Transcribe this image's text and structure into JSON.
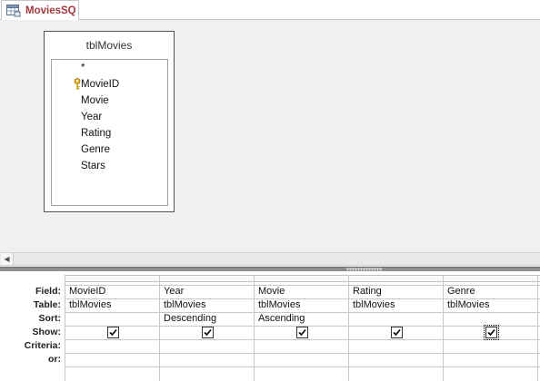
{
  "tab": {
    "label": "MoviesSQ"
  },
  "table": {
    "title": "tblMovies",
    "fields": [
      "*",
      "MovieID",
      "Movie",
      "Year",
      "Rating",
      "Genre",
      "Stars"
    ]
  },
  "grid": {
    "row_labels": [
      "Field:",
      "Table:",
      "Sort:",
      "Show:",
      "Criteria:",
      "or:"
    ],
    "columns": [
      {
        "field": "MovieID",
        "table": "tblMovies",
        "sort": "",
        "show": true
      },
      {
        "field": "Year",
        "table": "tblMovies",
        "sort": "Descending",
        "show": true
      },
      {
        "field": "Movie",
        "table": "tblMovies",
        "sort": "Ascending",
        "show": true
      },
      {
        "field": "Rating",
        "table": "tblMovies",
        "sort": "",
        "show": true
      },
      {
        "field": "Genre",
        "table": "tblMovies",
        "sort": "",
        "show": true
      }
    ]
  },
  "icons": {
    "tab": "query-icon",
    "key": "primary-key-icon",
    "scroll_left": "arrow-left-icon"
  },
  "colors": {
    "tab_text": "#a4373a",
    "splitter": "#8f8f8f"
  }
}
